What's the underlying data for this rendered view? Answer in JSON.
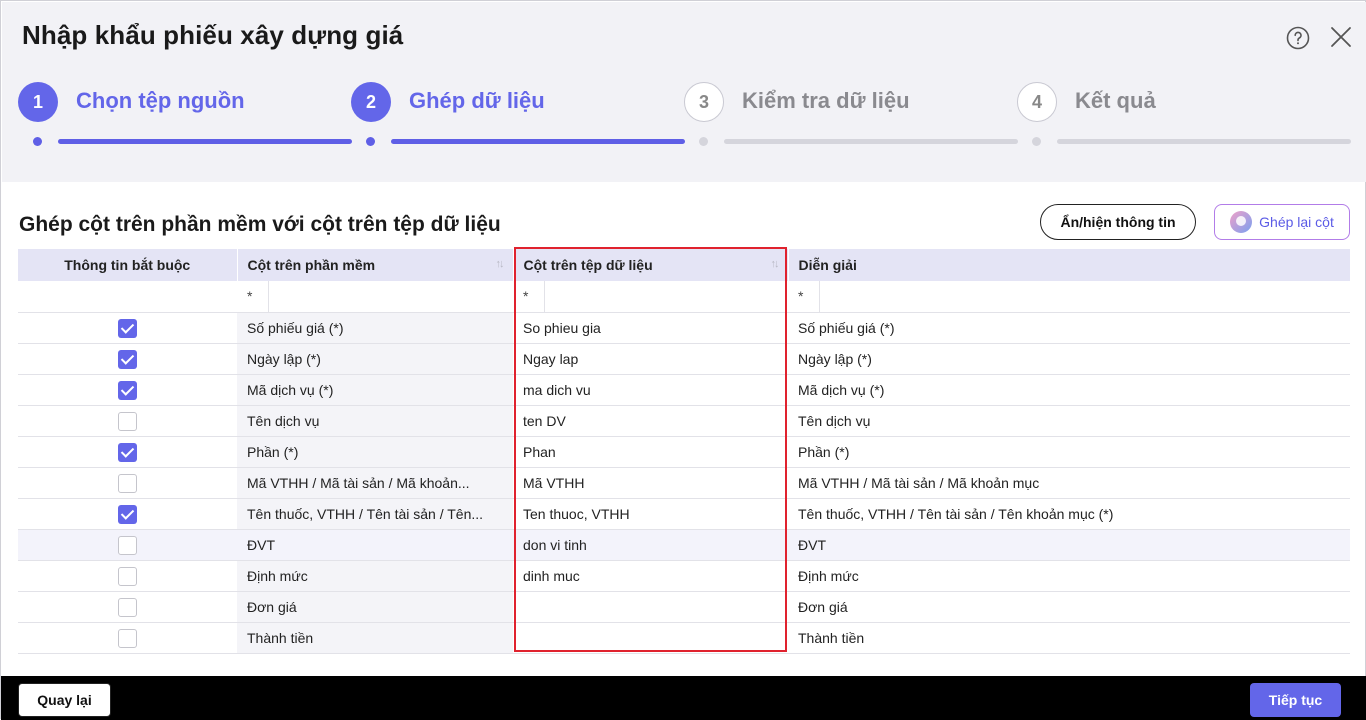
{
  "dialog": {
    "title": "Nhập khẩu phiếu xây dựng giá"
  },
  "steps": [
    {
      "number": "1",
      "label": "Chọn tệp nguồn",
      "state": "active"
    },
    {
      "number": "2",
      "label": "Ghép dữ liệu",
      "state": "active"
    },
    {
      "number": "3",
      "label": "Kiểm tra dữ liệu",
      "state": "inactive"
    },
    {
      "number": "4",
      "label": "Kết quả",
      "state": "inactive"
    }
  ],
  "section": {
    "title": "Ghép cột trên phần mềm với cột trên tệp dữ liệu",
    "toggle_info_label": "Ẩn/hiện thông tin",
    "remap_label": "Ghép lại cột"
  },
  "table": {
    "columns": [
      "Thông tin bắt buộc",
      "Cột trên phần mềm",
      "Cột trên tệp dữ liệu",
      "Diễn giải"
    ],
    "filter_symbol": "*",
    "rows": [
      {
        "required": true,
        "software_column": "Số phiếu giá (*)",
        "file_column": "So phieu gia",
        "description": "Số phiếu giá (*)"
      },
      {
        "required": true,
        "software_column": "Ngày lập (*)",
        "file_column": "Ngay lap",
        "description": "Ngày lập (*)"
      },
      {
        "required": true,
        "software_column": "Mã dịch vụ (*)",
        "file_column": "ma dich vu",
        "description": "Mã dịch vụ (*)"
      },
      {
        "required": false,
        "software_column": "Tên dịch vụ",
        "file_column": "ten DV",
        "description": "Tên dịch vụ"
      },
      {
        "required": true,
        "software_column": "Phần (*)",
        "file_column": "Phan",
        "description": "Phần (*)"
      },
      {
        "required": false,
        "software_column": "Mã VTHH / Mã tài sản / Mã khoản...",
        "file_column": "Mã VTHH",
        "description": "Mã VTHH / Mã tài sản / Mã khoản mục"
      },
      {
        "required": true,
        "software_column": "Tên thuốc, VTHH / Tên tài sản / Tên...",
        "file_column": "Ten thuoc, VTHH",
        "description": "Tên thuốc, VTHH / Tên tài sản / Tên khoản mục (*)"
      },
      {
        "required": false,
        "software_column": "ĐVT",
        "file_column": "don vi tinh",
        "description": "ĐVT"
      },
      {
        "required": false,
        "software_column": "Định mức",
        "file_column": "dinh muc",
        "description": "Định mức"
      },
      {
        "required": false,
        "software_column": "Đơn giá",
        "file_column": "",
        "description": "Đơn giá"
      },
      {
        "required": false,
        "software_column": "Thành tiền",
        "file_column": "",
        "description": "Thành tiền"
      }
    ]
  },
  "footer": {
    "back_label": "Quay lại",
    "next_label": "Tiếp tục"
  },
  "colors": {
    "accent": "#6366e9",
    "highlight_border": "#e0222e",
    "footer_bg": "#000000"
  }
}
